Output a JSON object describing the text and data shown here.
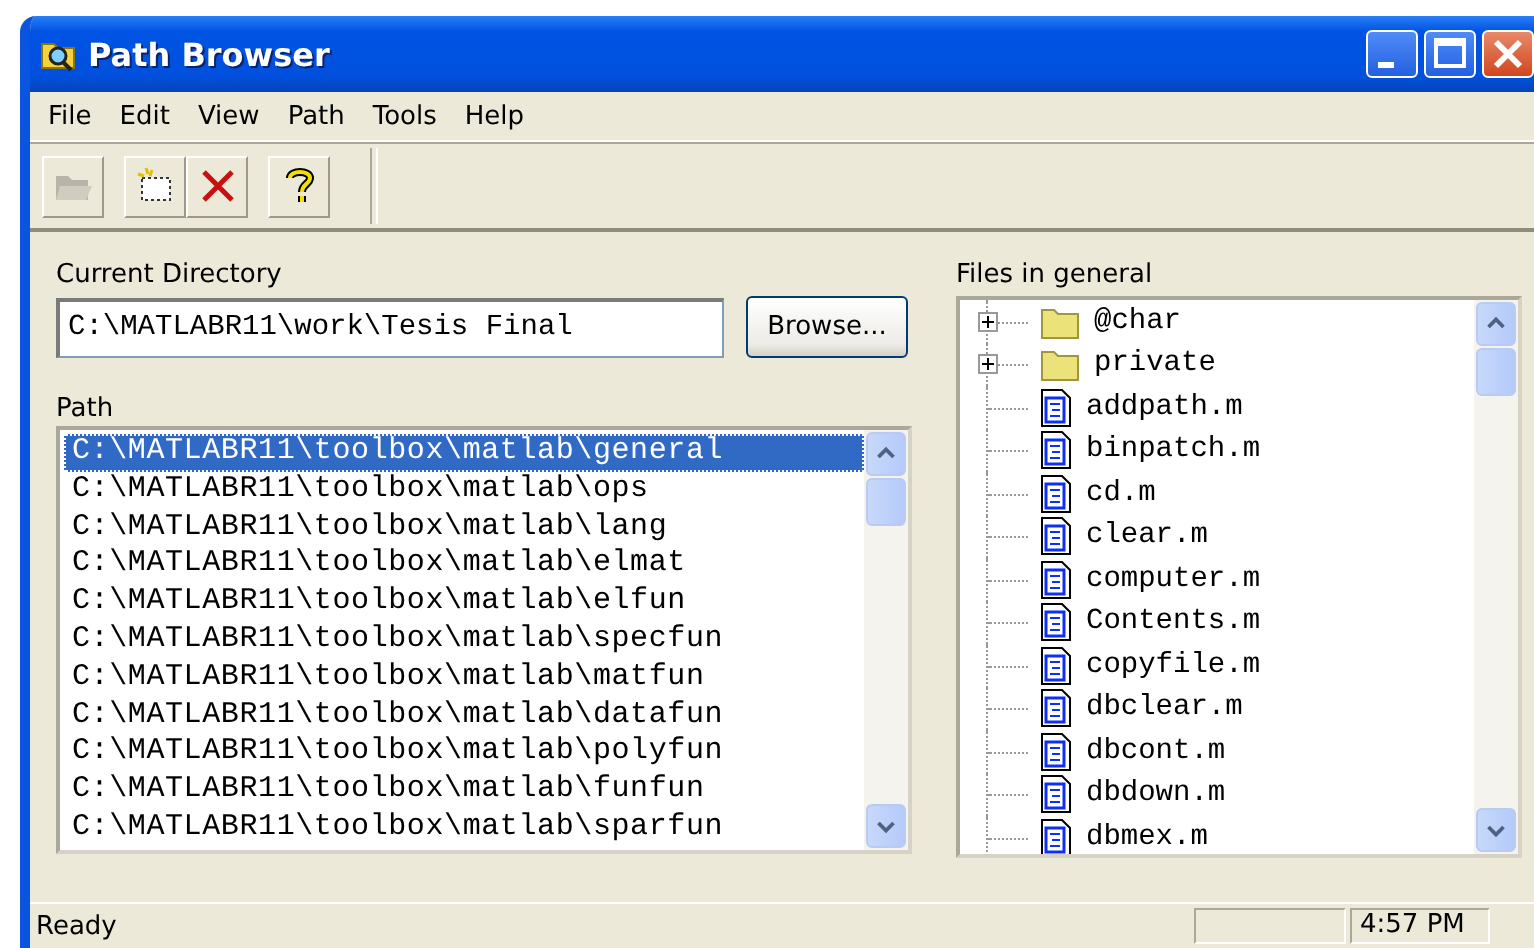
{
  "window": {
    "title": "Path Browser"
  },
  "menu": [
    "File",
    "Edit",
    "View",
    "Path",
    "Tools",
    "Help"
  ],
  "toolbar": [
    {
      "kind": "open",
      "disabled": true
    },
    {
      "kind": "new",
      "disabled": false
    },
    {
      "kind": "delete",
      "disabled": false
    },
    {
      "kind": "help",
      "disabled": false
    }
  ],
  "current_directory": {
    "label": "Current Directory",
    "value": "C:\\MATLABR11\\work\\Tesis Final"
  },
  "browse_button": "Browse...",
  "path": {
    "label": "Path",
    "items": [
      {
        "text": "C:\\MATLABR11\\toolbox\\matlab\\general",
        "selected": true
      },
      {
        "text": "C:\\MATLABR11\\toolbox\\matlab\\ops",
        "selected": false
      },
      {
        "text": "C:\\MATLABR11\\toolbox\\matlab\\lang",
        "selected": false
      },
      {
        "text": "C:\\MATLABR11\\toolbox\\matlab\\elmat",
        "selected": false
      },
      {
        "text": "C:\\MATLABR11\\toolbox\\matlab\\elfun",
        "selected": false
      },
      {
        "text": "C:\\MATLABR11\\toolbox\\matlab\\specfun",
        "selected": false
      },
      {
        "text": "C:\\MATLABR11\\toolbox\\matlab\\matfun",
        "selected": false
      },
      {
        "text": "C:\\MATLABR11\\toolbox\\matlab\\datafun",
        "selected": false
      },
      {
        "text": "C:\\MATLABR11\\toolbox\\matlab\\polyfun",
        "selected": false
      },
      {
        "text": "C:\\MATLABR11\\toolbox\\matlab\\funfun",
        "selected": false
      },
      {
        "text": "C:\\MATLABR11\\toolbox\\matlab\\sparfun",
        "selected": false
      }
    ]
  },
  "files": {
    "label": "Files in general",
    "items": [
      {
        "kind": "folder",
        "name": "@char",
        "expanded": false
      },
      {
        "kind": "folder",
        "name": "private",
        "expanded": false
      },
      {
        "kind": "file",
        "name": "addpath.m"
      },
      {
        "kind": "file",
        "name": "binpatch.m"
      },
      {
        "kind": "file",
        "name": "cd.m"
      },
      {
        "kind": "file",
        "name": "clear.m"
      },
      {
        "kind": "file",
        "name": "computer.m"
      },
      {
        "kind": "file",
        "name": "Contents.m"
      },
      {
        "kind": "file",
        "name": "copyfile.m"
      },
      {
        "kind": "file",
        "name": "dbclear.m"
      },
      {
        "kind": "file",
        "name": "dbcont.m"
      },
      {
        "kind": "file",
        "name": "dbdown.m"
      },
      {
        "kind": "file",
        "name": "dbmex.m"
      }
    ]
  },
  "status_bar": {
    "message": "Ready",
    "time": "4:57 PM"
  }
}
